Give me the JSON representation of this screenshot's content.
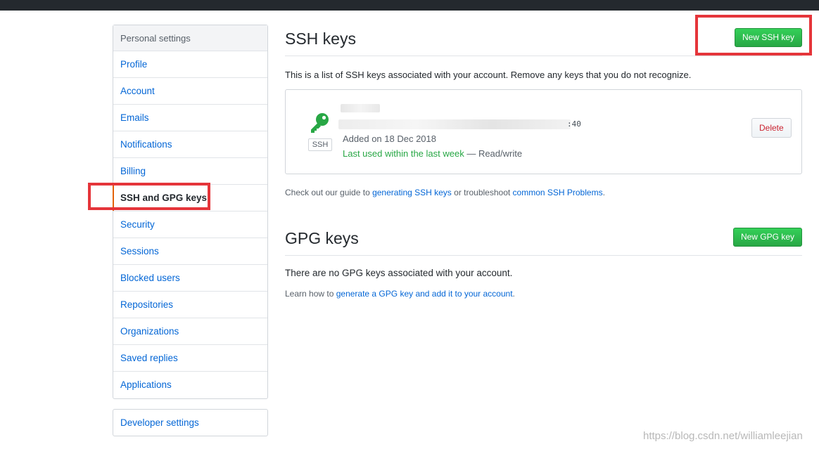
{
  "sidebar": {
    "heading": "Personal settings",
    "items": [
      {
        "label": "Profile"
      },
      {
        "label": "Account"
      },
      {
        "label": "Emails"
      },
      {
        "label": "Notifications"
      },
      {
        "label": "Billing"
      },
      {
        "label": "SSH and GPG keys",
        "selected": true
      },
      {
        "label": "Security"
      },
      {
        "label": "Sessions"
      },
      {
        "label": "Blocked users"
      },
      {
        "label": "Repositories"
      },
      {
        "label": "Organizations"
      },
      {
        "label": "Saved replies"
      },
      {
        "label": "Applications"
      }
    ],
    "developer": "Developer settings"
  },
  "ssh": {
    "title": "SSH keys",
    "new_button": "New SSH key",
    "description": "This is a list of SSH keys associated with your account. Remove any keys that you do not recognize.",
    "key": {
      "type_label": "SSH",
      "fingerprint_tail": ":40",
      "added": "Added on 18 Dec 2018",
      "last_used": "Last used within the last week",
      "access": " — Read/write",
      "delete_label": "Delete"
    },
    "guide": {
      "prefix": "Check out our guide to ",
      "link1": "generating SSH keys",
      "middle": " or troubleshoot ",
      "link2": "common SSH Problems",
      "suffix": "."
    }
  },
  "gpg": {
    "title": "GPG keys",
    "new_button": "New GPG key",
    "empty": "There are no GPG keys associated with your account.",
    "learn": {
      "prefix": "Learn how to ",
      "link": "generate a GPG key and add it to your account",
      "suffix": "."
    }
  },
  "watermark": "https://blog.csdn.net/williamleejian",
  "colors": {
    "accent_green": "#28a745",
    "link_blue": "#0366d6",
    "annotation_red": "#e5353a",
    "selected_marker": "#e36209"
  }
}
